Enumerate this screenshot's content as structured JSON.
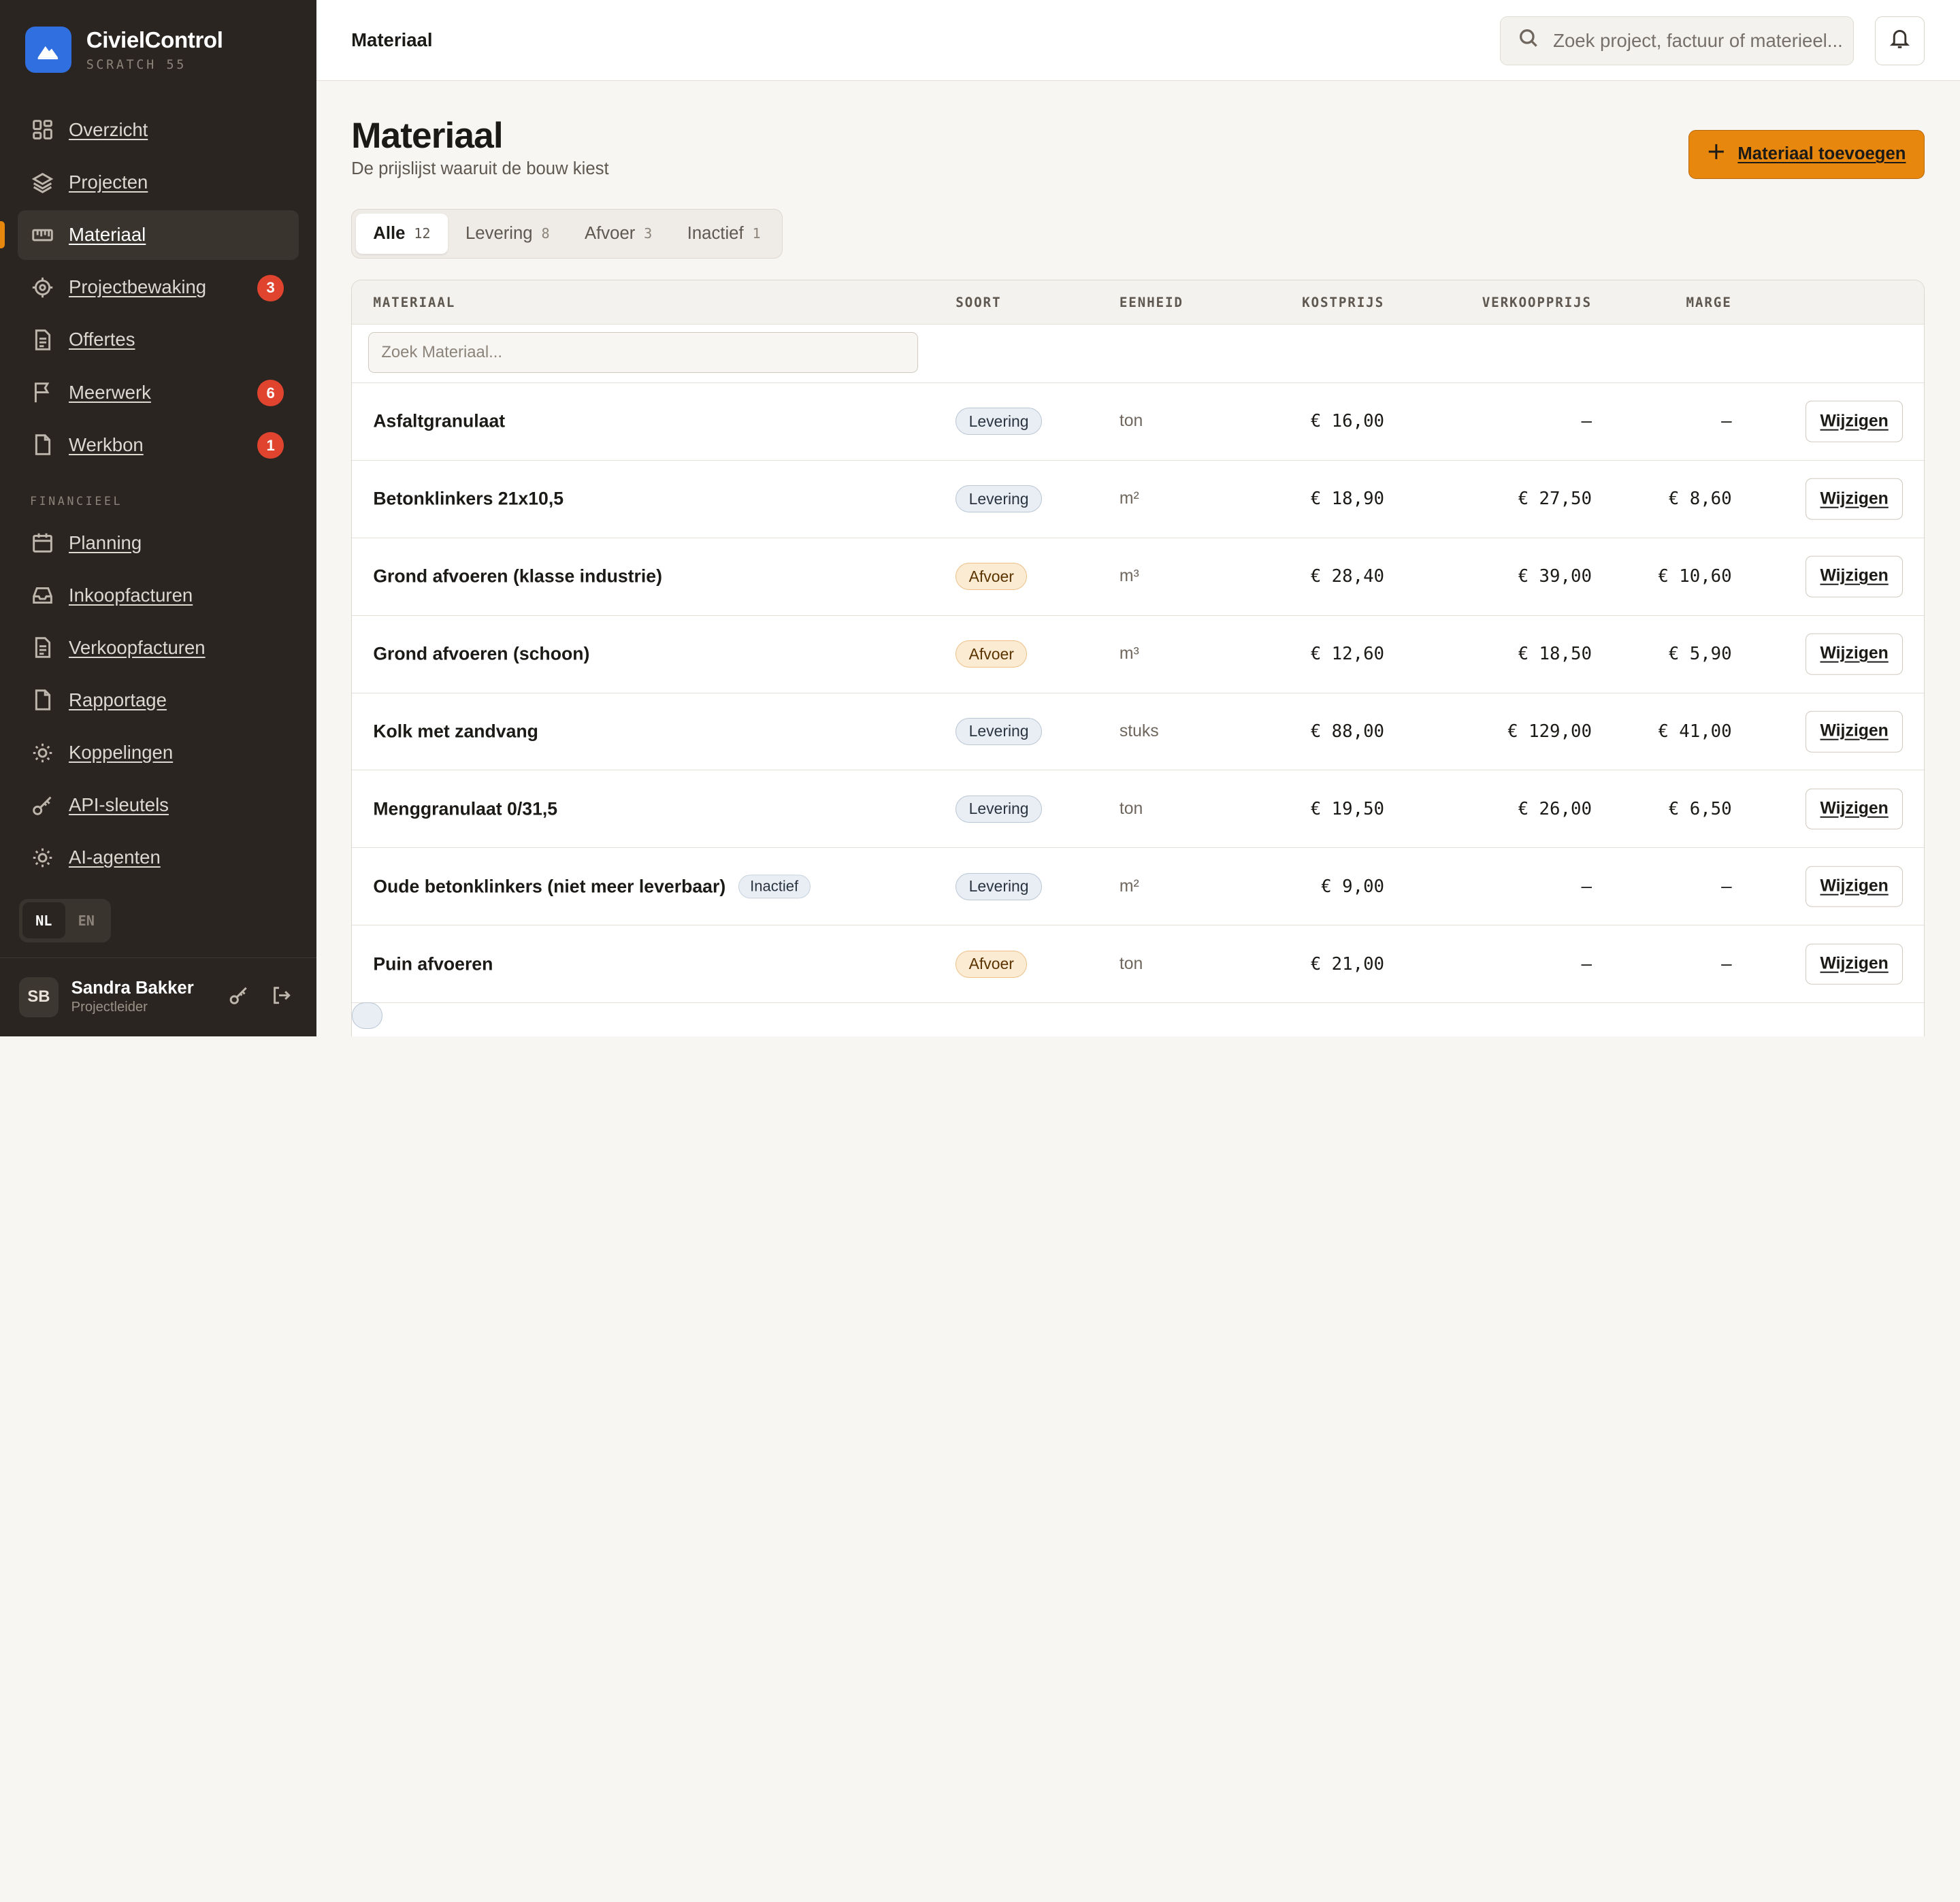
{
  "brand": {
    "name": "CivielControl",
    "sub": "SCRATCH 55",
    "logo_icon": "mountain-icon",
    "logo_color": "#2f6fe0"
  },
  "nav": {
    "items": [
      {
        "label": "Overzicht",
        "icon": "grid-icon"
      },
      {
        "label": "Projecten",
        "icon": "layers-icon"
      },
      {
        "label": "Materiaal",
        "icon": "ruler-icon",
        "active": true
      },
      {
        "label": "Projectbewaking",
        "icon": "target-icon",
        "badge": "3"
      },
      {
        "label": "Offertes",
        "icon": "document-icon"
      },
      {
        "label": "Meerwerk",
        "icon": "flag-icon",
        "badge": "6"
      },
      {
        "label": "Werkbon",
        "icon": "file-icon",
        "badge": "1"
      }
    ],
    "section_label": "FINANCIEEL",
    "finance_items": [
      {
        "label": "Planning",
        "icon": "calendar-icon"
      },
      {
        "label": "Inkoopfacturen",
        "icon": "inbox-icon"
      },
      {
        "label": "Verkoopfacturen",
        "icon": "document-icon"
      },
      {
        "label": "Rapportage",
        "icon": "file-icon"
      },
      {
        "label": "Koppelingen",
        "icon": "sun-icon"
      },
      {
        "label": "API-sleutels",
        "icon": "key-icon"
      },
      {
        "label": "AI-agenten",
        "icon": "sun-icon"
      }
    ]
  },
  "lang": {
    "nl": "NL",
    "en": "EN",
    "selected": "NL"
  },
  "user": {
    "initials": "SB",
    "name": "Sandra Bakker",
    "role": "Projectleider"
  },
  "topbar": {
    "title": "Materiaal",
    "search_placeholder": "Zoek project, factuur of materieel..."
  },
  "page": {
    "title": "Materiaal",
    "subtitle": "De prijslijst waaruit de bouw kiest",
    "add_button": "Materiaal toevoegen",
    "accent": "#e8870e"
  },
  "tabs": [
    {
      "label": "Alle",
      "count": "12",
      "active": true
    },
    {
      "label": "Levering",
      "count": "8"
    },
    {
      "label": "Afvoer",
      "count": "3"
    },
    {
      "label": "Inactief",
      "count": "1"
    }
  ],
  "table": {
    "headers": {
      "materiaal": "MATERIAAL",
      "soort": "SOORT",
      "eenheid": "EENHEID",
      "kostprijs": "KOSTPRIJS",
      "verkoopprijs": "VERKOOPPRIJS",
      "marge": "MARGE"
    },
    "filter_placeholder": "Zoek Materiaal...",
    "edit_label": "Wijzigen",
    "inactive_label": "Inactief",
    "rows": [
      {
        "name": "Asfaltgranulaat",
        "type": "Levering",
        "unit": "ton",
        "cost": "€ 16,00",
        "sell": "—",
        "marge": "—"
      },
      {
        "name": "Betonklinkers 21x10,5",
        "type": "Levering",
        "unit": "m²",
        "cost": "€ 18,90",
        "sell": "€ 27,50",
        "marge": "€ 8,60"
      },
      {
        "name": "Grond afvoeren (klasse industrie)",
        "type": "Afvoer",
        "unit": "m³",
        "cost": "€ 28,40",
        "sell": "€ 39,00",
        "marge": "€ 10,60"
      },
      {
        "name": "Grond afvoeren (schoon)",
        "type": "Afvoer",
        "unit": "m³",
        "cost": "€ 12,60",
        "sell": "€ 18,50",
        "marge": "€ 5,90"
      },
      {
        "name": "Kolk met zandvang",
        "type": "Levering",
        "unit": "stuks",
        "cost": "€ 88,00",
        "sell": "€ 129,00",
        "marge": "€ 41,00"
      },
      {
        "name": "Menggranulaat 0/31,5",
        "type": "Levering",
        "unit": "ton",
        "cost": "€ 19,50",
        "sell": "€ 26,00",
        "marge": "€ 6,50"
      },
      {
        "name": "Oude betonklinkers (niet meer leverbaar)",
        "type": "Levering",
        "unit": "m²",
        "cost": "€ 9,00",
        "sell": "—",
        "marge": "—",
        "inactive": true
      },
      {
        "name": "Puin afvoeren",
        "type": "Afvoer",
        "unit": "ton",
        "cost": "€ 21,00",
        "sell": "—",
        "marge": "—"
      }
    ]
  }
}
